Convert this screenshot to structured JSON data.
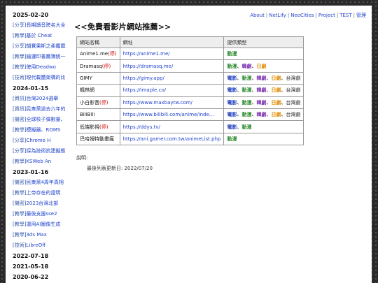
{
  "sidebar": [
    {
      "kind": "date",
      "text": "2025-02-20"
    },
    {
      "kind": "item",
      "tag": "[分享]",
      "title": "長期讀音跨名大全"
    },
    {
      "kind": "item",
      "tag": "[教學]",
      "title": "基於 Cheat"
    },
    {
      "kind": "item",
      "tag": "[分享]",
      "title": "韻覺果斯之柔鑑載"
    },
    {
      "kind": "item",
      "tag": "[教學]",
      "title": "繪灑印書鷹簿統一"
    },
    {
      "kind": "item",
      "tag": "[教學]",
      "title": "使用Deadwo"
    },
    {
      "kind": "item",
      "tag": "[技術]",
      "title": "現代載體架構的比"
    },
    {
      "kind": "date",
      "text": "2024-01-15"
    },
    {
      "kind": "item",
      "tag": "[資訊]",
      "title": "台灣2024選舉"
    },
    {
      "kind": "item",
      "tag": "[資訊]",
      "title": "民衆黨過去六年的"
    },
    {
      "kind": "item",
      "tag": "[機密]",
      "title": "全球核子彈數量、"
    },
    {
      "kind": "item",
      "tag": "[教學]",
      "title": "模擬器、ROMS"
    },
    {
      "kind": "item",
      "tag": "[分享]",
      "title": "Chrome H"
    },
    {
      "kind": "item",
      "tag": "[分享]",
      "title": "採為技術抗建擬態"
    },
    {
      "kind": "item",
      "tag": "[教學]",
      "title": "KSWeb An"
    },
    {
      "kind": "date",
      "text": "2023-01-16"
    },
    {
      "kind": "item",
      "tag": "[機密]",
      "title": "民衆黨4周年真相"
    },
    {
      "kind": "item",
      "tag": "[教學]",
      "title": "上帝存在的證明"
    },
    {
      "kind": "item",
      "tag": "[機密]",
      "title": "2023台灣北部"
    },
    {
      "kind": "item",
      "tag": "[教學]",
      "title": "最後支援sse2"
    },
    {
      "kind": "item",
      "tag": "[教學]",
      "title": "運用AI圖像生成"
    },
    {
      "kind": "item",
      "tag": "[教學]",
      "title": "3ds Max"
    },
    {
      "kind": "item",
      "tag": "[技術]",
      "title": "LibreOff"
    },
    {
      "kind": "date",
      "text": "2022-07-18"
    },
    {
      "kind": "date",
      "text": "2021-05-18"
    },
    {
      "kind": "date",
      "text": "2020-06-22"
    }
  ],
  "nav": [
    {
      "label": "About"
    },
    {
      "label": "NetLify"
    },
    {
      "label": "NeoCities"
    },
    {
      "label": "Project"
    },
    {
      "label": "TEST"
    },
    {
      "label": "管理"
    }
  ],
  "page_title": "<<免費看影片網站推薦>>",
  "table": {
    "headers": [
      "網站名稱",
      "網址",
      "提供類型"
    ],
    "rows": [
      {
        "name": "Anime1.me",
        "warn": "(停)",
        "url": "https://anime1.me/",
        "types": [
          {
            "t": "動漫",
            "c": "anime"
          }
        ]
      },
      {
        "name": "Dramasq",
        "warn": "(停)",
        "url": "https://dramasq.me/",
        "types": [
          {
            "t": "動漫",
            "c": "anime"
          },
          {
            "t": "韓劇",
            "c": "korean"
          },
          {
            "t": "日劇",
            "c": "japan"
          }
        ]
      },
      {
        "name": "GIMY",
        "warn": "",
        "url": "https://gimy.app/",
        "types": [
          {
            "t": "電影",
            "c": "movie"
          },
          {
            "t": "動漫",
            "c": "anime"
          },
          {
            "t": "韓劇",
            "c": "korean"
          },
          {
            "t": "日劇",
            "c": "japan"
          },
          {
            "t": "台灣劇",
            "c": "taiwan"
          }
        ]
      },
      {
        "name": "楓林網",
        "warn": "",
        "url": "https://imaple.co/",
        "types": [
          {
            "t": "電影",
            "c": "movie"
          },
          {
            "t": "動漫",
            "c": "anime"
          },
          {
            "t": "韓劇",
            "c": "korean"
          },
          {
            "t": "日劇",
            "c": "japan"
          },
          {
            "t": "台灣劇",
            "c": "taiwan"
          }
        ]
      },
      {
        "name": "小白影音",
        "warn": "(停)",
        "url": "https://www.maxbaytw.com/",
        "types": [
          {
            "t": "電影",
            "c": "movie"
          },
          {
            "t": "動漫",
            "c": "anime"
          },
          {
            "t": "韓劇",
            "c": "korean"
          },
          {
            "t": "日劇",
            "c": "japan"
          },
          {
            "t": "台灣劇",
            "c": "taiwan"
          }
        ]
      },
      {
        "name": "BiliBili",
        "warn": "",
        "url": "https://www.bilibili.com/anime/inde...",
        "types": [
          {
            "t": "電影",
            "c": "movie"
          },
          {
            "t": "動漫",
            "c": "anime"
          },
          {
            "t": "韓劇",
            "c": "korean"
          },
          {
            "t": "日劇",
            "c": "japan"
          },
          {
            "t": "台灣劇",
            "c": "taiwan"
          }
        ]
      },
      {
        "name": "低端影視",
        "warn": "(停)",
        "url": "https://ddys.tv/",
        "types": [
          {
            "t": "電影",
            "c": "movie"
          },
          {
            "t": "動漫",
            "c": "anime"
          }
        ]
      },
      {
        "name": "巴哈姆特動畫瘋",
        "warn": "",
        "url": "https://ani.gamer.com.tw/animeList.php",
        "types": [
          {
            "t": "動漫",
            "c": "anime"
          }
        ]
      }
    ]
  },
  "note_label": "說明:",
  "last_updated": "最後列表更新日: 2022/07/20"
}
